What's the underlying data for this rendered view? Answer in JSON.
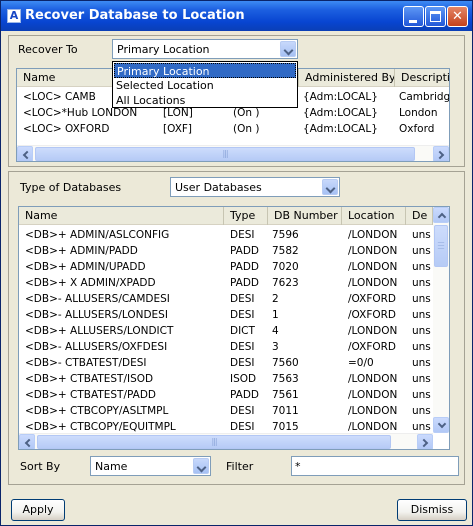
{
  "window": {
    "title": "Recover Database to Location"
  },
  "recover_to": {
    "label": "Recover To",
    "value": "Primary Location",
    "options": [
      "Primary Location",
      "Selected Location",
      "All Locations"
    ]
  },
  "locations": {
    "columns": [
      "Name",
      "",
      "",
      "Administered By",
      "Descriptio"
    ],
    "rows": [
      {
        "name": "<LOC>    CAMB",
        "code": "",
        "status": "",
        "admin": "{Adm:LOCAL}",
        "desc": "Cambridge"
      },
      {
        "name": "<LOC>*Hub   LONDON",
        "code": "[LON]",
        "status": "(On )",
        "admin": "{Adm:LOCAL}",
        "desc": "London"
      },
      {
        "name": "<LOC>      OXFORD",
        "code": "[OXF]",
        "status": "(On )",
        "admin": "{Adm:LOCAL}",
        "desc": "Oxford"
      }
    ],
    "scroll_grip": "|||"
  },
  "database_type": {
    "label": "Type of Databases",
    "value": "User Databases"
  },
  "databases": {
    "columns": [
      "Name",
      "Type",
      "DB Number",
      "Location",
      "De"
    ],
    "rows": [
      {
        "name": "<DB>+    ADMIN/ASLCONFIG",
        "type": "DESI",
        "num": "7596",
        "loc": "/LONDON",
        "desc": "uns"
      },
      {
        "name": "<DB>+    ADMIN/PADD",
        "type": "PADD",
        "num": "7582",
        "loc": "/LONDON",
        "desc": "uns"
      },
      {
        "name": "<DB>+    ADMIN/UPADD",
        "type": "PADD",
        "num": "7020",
        "loc": "/LONDON",
        "desc": "uns"
      },
      {
        "name": "<DB>+ X  ADMIN/XPADD",
        "type": "PADD",
        "num": "7623",
        "loc": "/LONDON",
        "desc": "uns"
      },
      {
        "name": "<DB>-    ALLUSERS/CAMDESI",
        "type": "DESI",
        "num": "2",
        "loc": "/OXFORD",
        "desc": "uns"
      },
      {
        "name": "<DB>-    ALLUSERS/LONDESI",
        "type": "DESI",
        "num": "1",
        "loc": "/OXFORD",
        "desc": "uns"
      },
      {
        "name": "<DB>+    ALLUSERS/LONDICT",
        "type": "DICT",
        "num": "4",
        "loc": "/LONDON",
        "desc": "uns"
      },
      {
        "name": "<DB>-    ALLUSERS/OXFDESI",
        "type": "DESI",
        "num": "3",
        "loc": "/OXFORD",
        "desc": "uns"
      },
      {
        "name": "<DB>-    CTBATEST/DESI",
        "type": "DESI",
        "num": "7560",
        "loc": "=0/0",
        "desc": "uns"
      },
      {
        "name": "<DB>+     CTBATEST/ISOD",
        "type": "ISOD",
        "num": "7563",
        "loc": "/LONDON",
        "desc": "uns"
      },
      {
        "name": "<DB>+     CTBATEST/PADD",
        "type": "PADD",
        "num": "7561",
        "loc": "/LONDON",
        "desc": "uns"
      },
      {
        "name": "<DB>+    CTBCOPY/ASLTMPL",
        "type": "DESI",
        "num": "7011",
        "loc": "/LONDON",
        "desc": "uns"
      },
      {
        "name": "<DB>+    CTBCOPY/EQUITMPL",
        "type": "DESI",
        "num": "7015",
        "loc": "/LONDON",
        "desc": "uns"
      }
    ],
    "scroll_grip": "|||"
  },
  "sort_by": {
    "label": "Sort By",
    "value": "Name"
  },
  "filter": {
    "label": "Filter",
    "value": "*"
  },
  "buttons": {
    "apply": "Apply",
    "dismiss": "Dismiss"
  },
  "colors": {
    "title_bar": "#0845d1",
    "selection": "#316ac5",
    "window_bg": "#ece9d8"
  }
}
